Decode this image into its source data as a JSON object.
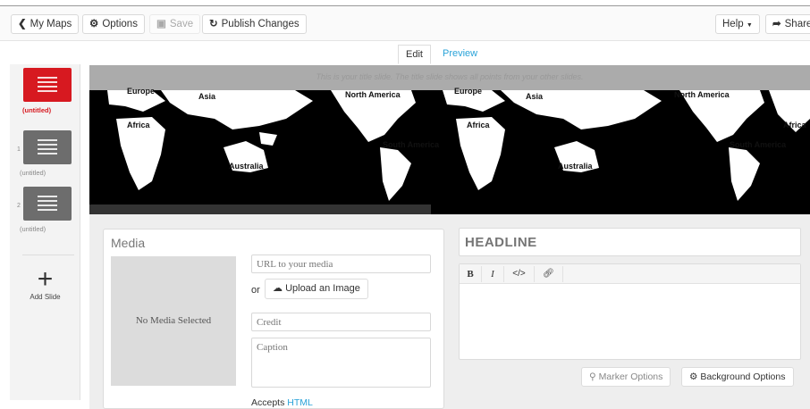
{
  "toolbar": {
    "my_maps": "My Maps",
    "options": "Options",
    "save": "Save",
    "publish": "Publish Changes",
    "help": "Help",
    "share": "Share"
  },
  "tabs": {
    "edit": "Edit",
    "preview": "Preview"
  },
  "sidebar": {
    "slides": [
      {
        "label": "(untitled)"
      },
      {
        "number": "1",
        "label": "(untitled)"
      },
      {
        "number": "2",
        "label": "(untitled)"
      }
    ],
    "add_slide": "Add Slide"
  },
  "map": {
    "title_slide_note": "This is your title slide. The title slide shows all points from your other slides.",
    "continents": [
      "Europe",
      "Asia",
      "Africa",
      "Australia",
      "North America",
      "South America"
    ]
  },
  "media": {
    "heading": "Media",
    "empty_text": "No Media Selected",
    "url_placeholder": "URL to your media",
    "or": "or",
    "upload_label": "Upload an Image",
    "credit_placeholder": "Credit",
    "caption_placeholder": "Caption",
    "accepts_prefix": "Accepts",
    "accepts_link": "HTML"
  },
  "text": {
    "headline_placeholder": "HEADLINE",
    "bold": "B",
    "italic": "I",
    "code": "</>",
    "link_icon": "link-icon"
  },
  "options": {
    "marker": "Marker Options",
    "background": "Background Options"
  }
}
